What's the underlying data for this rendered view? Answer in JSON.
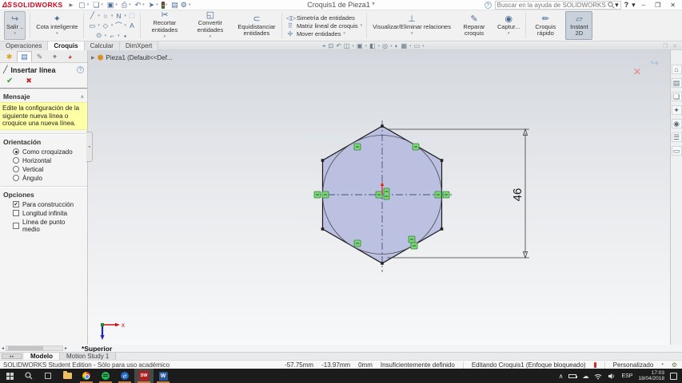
{
  "titlebar": {
    "logo_mark": "ΔS",
    "logo_text": "SOLIDWORKS",
    "doc_title": "Croquis1 de Pieza1 *",
    "search_placeholder": "Buscar en la ayuda de SOLIDWORKS",
    "help_label": "?",
    "minimize": "–",
    "restore": "❐",
    "close": "✕"
  },
  "icons": {
    "caret": "▾",
    "new": "▢",
    "open": "❏",
    "save": "▣",
    "print": "⎙",
    "undo": "↶",
    "select": "➤",
    "options_doc": "▤",
    "gear": "⚙",
    "exit_sketch": "↪",
    "smart_dim": "✦",
    "line": "╱",
    "circle": "○",
    "spline": "N",
    "rect_ghost": "▢",
    "rect": "▭",
    "polygon": "◇",
    "text": "A",
    "ellipse": "⊙",
    "arc": "⌒",
    "fillet": "⌐",
    "point": "▪",
    "trim": "✂",
    "convert": "◱",
    "offset": "⊂",
    "mirror": "◁▷",
    "pattern": "⠿",
    "move": "✢",
    "relations": "⊥",
    "repair": "✎",
    "capture": "◉",
    "rapid": "✏",
    "instant": "▱",
    "zoom_fit": "⌖",
    "zoom_area": "⊡",
    "prev_view": "↶",
    "section": "◫",
    "orientation_cube": "▣",
    "display_style": "◧",
    "hide_show": "◎",
    "appearance": "◐",
    "scene": "▦",
    "view_settings": "▭",
    "pm_tab1": "✱",
    "pm_tab2": "▤",
    "pm_tab3": "✎",
    "pm_tab4": "⌖",
    "pm_tab5": "◕",
    "tree_arrow": "▶",
    "part": "⬢",
    "home": "⌂",
    "library": "▤",
    "explorer": "❏",
    "palette": "✦",
    "appearance2": "◉",
    "props": "☰",
    "screen": "▭",
    "check": "✔",
    "cross": "✖",
    "help": "?",
    "collapse": "∧",
    "exit_arrow": "⇤",
    "corner_close": "✕",
    "scroll_left": "◂",
    "scroll_right": "▸",
    "tabscroll": "◂▸",
    "tray_chevron": "∧",
    "cloud": "☁",
    "wifi": "ᛒ",
    "speaker": "◁"
  },
  "ribbon": {
    "exit_sketch": "Salir ..",
    "smart_dimension": "Cota inteligente",
    "trim": "Recortar entidades",
    "convert": "Convertir entidades",
    "offset": "Equidistanciar entidades",
    "mirror": "Simetría de entidades",
    "pattern": "Matriz lineal de croquis",
    "move": "Mover entidades",
    "relations": "Visualizar/Eliminar relaciones",
    "repair": "Reparar croquis",
    "capture": "Captur...",
    "rapid_sketch": "Croquis rápido",
    "instant2d": "Instant 2D"
  },
  "tabs": {
    "items": [
      "Operaciones",
      "Croquis",
      "Calcular",
      "DimXpert"
    ],
    "active": "Croquis"
  },
  "panel": {
    "title": "Insertar línea",
    "message_header": "Mensaje",
    "message": "Edite la configuración de la siguiente nueva línea o croquice una nueva línea.",
    "orientation": {
      "header": "Orientación",
      "options": [
        "Como croquizado",
        "Horizontal",
        "Vertical",
        "Ángulo"
      ],
      "selected": "Como croquizado"
    },
    "options": {
      "header": "Opciones",
      "items": [
        {
          "label": "Para construcción",
          "checked": true
        },
        {
          "label": "Longitud infinita",
          "checked": false
        },
        {
          "label": "Línea de punto medio",
          "checked": false
        }
      ]
    }
  },
  "viewport": {
    "tree_item": "Pieza1  (Default<<Def...",
    "dimension_value": "46",
    "axis_label": "x",
    "view_label": "*Superior"
  },
  "bottom": {
    "model_tab": "Modelo",
    "motion_tab": "Motion Study 1"
  },
  "statusbar": {
    "edition": "SOLIDWORKS Student Edition - Sólo para uso académico",
    "x": "-57.75mm",
    "y": "-13.97mm",
    "z": "0mm",
    "definition": "Insuficientemente definido",
    "editing": "Editando Croquis1 (Enfoque bloqueado)",
    "profile": "Personalizado"
  },
  "taskbar": {
    "sw_label": "SW",
    "word_label": "W",
    "teamviewer_label": "⇄",
    "lang": "ESP",
    "time": "17:03",
    "date": "18/04/2018"
  },
  "colors": {
    "accent_red": "#d6001c",
    "hexagon_fill": "#b7bbdf",
    "badge_green": "#7ed47e",
    "message_yellow": "#ffffa6",
    "taskbar_bg": "#1c1c1c"
  }
}
